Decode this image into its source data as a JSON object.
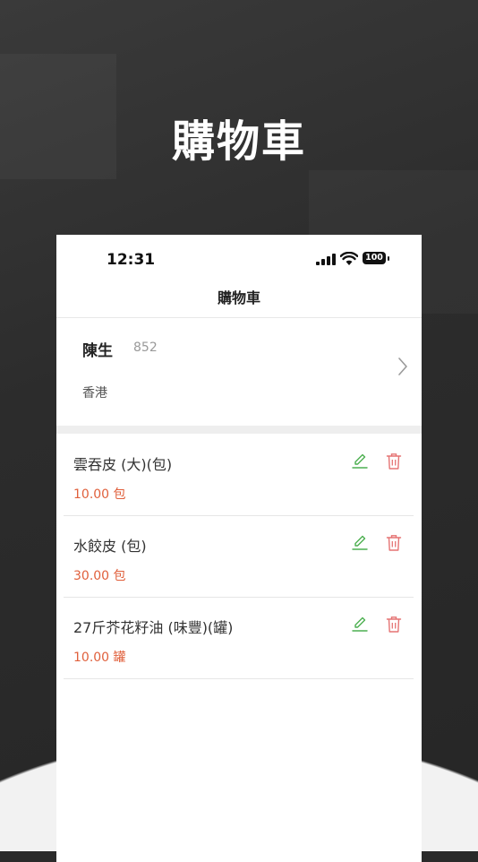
{
  "hero": {
    "title": "購物車"
  },
  "status_bar": {
    "time": "12:31",
    "battery": "100"
  },
  "navbar": {
    "title": "購物車"
  },
  "address": {
    "name": "陳生",
    "phone": "852",
    "text": "香港"
  },
  "cart": {
    "items": [
      {
        "name": "雲吞皮 (大)(包)",
        "price": "10.00 包"
      },
      {
        "name": "水餃皮 (包)",
        "price": "30.00 包"
      },
      {
        "name": "27斤芥花籽油 (味豐)(罐)",
        "price": "10.00 罐"
      }
    ]
  },
  "colors": {
    "edit_icon": "#4caf50",
    "delete_icon": "#e57373",
    "price": "#e0603c"
  }
}
